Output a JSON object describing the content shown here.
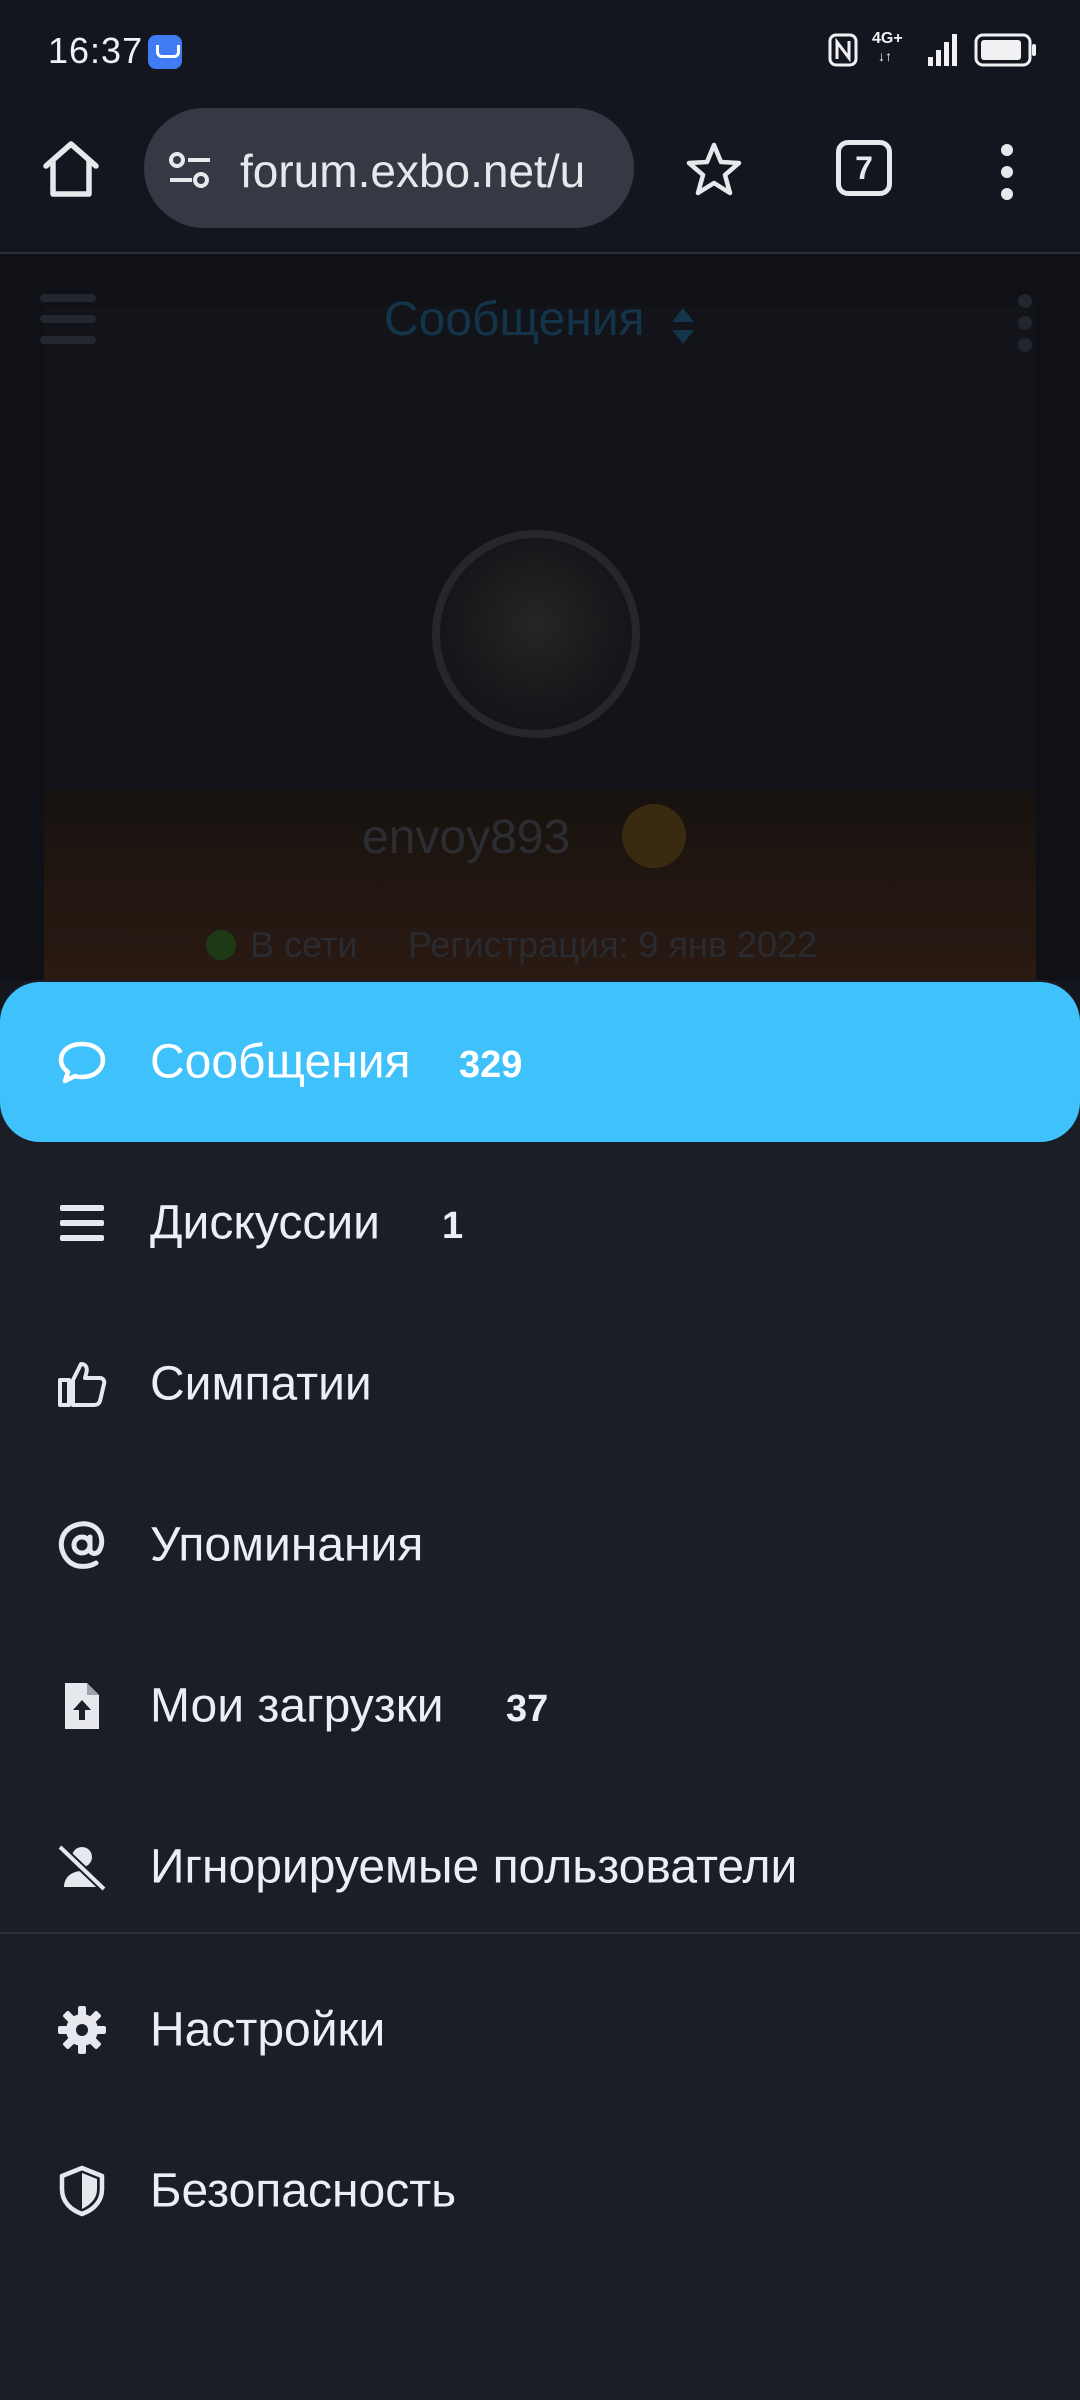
{
  "status_bar": {
    "time": "16:37",
    "network": "4G+",
    "icons": [
      "app-notification-icon",
      "nfc-icon",
      "signal-icon",
      "battery-icon"
    ]
  },
  "browser": {
    "url": "forum.exbo.net/u",
    "tab_count": "7",
    "icons": [
      "home-icon",
      "site-settings-icon",
      "bookmark-star-icon",
      "tabs-icon",
      "more-vert-icon"
    ]
  },
  "page_behind": {
    "header_title": "Сообщения",
    "username": "envoy893",
    "online_label": "В сети",
    "registration": "Регистрация: 9 янв 2022"
  },
  "menu": {
    "items": [
      {
        "label": "Сообщения",
        "count": "329",
        "icon": "comment-icon",
        "active": true
      },
      {
        "label": "Дискуссии",
        "count": "1",
        "icon": "list-icon",
        "active": false
      },
      {
        "label": "Симпатии",
        "count": "",
        "icon": "thumbs-up-icon",
        "active": false
      },
      {
        "label": "Упоминания",
        "count": "",
        "icon": "at-sign-icon",
        "active": false
      },
      {
        "label": "Мои загрузки",
        "count": "37",
        "icon": "file-upload-icon",
        "active": false
      },
      {
        "label": "Игнорируемые пользователи",
        "count": "",
        "icon": "user-slash-icon",
        "active": false
      },
      {
        "label": "Настройки",
        "count": "",
        "icon": "gear-icon",
        "active": false
      },
      {
        "label": "Безопасность",
        "count": "",
        "icon": "shield-icon",
        "active": false
      }
    ]
  },
  "colors": {
    "accent": "#3fc2fb",
    "sheet_bg": "#1b1d27",
    "toolbar_bg": "#13161e"
  }
}
